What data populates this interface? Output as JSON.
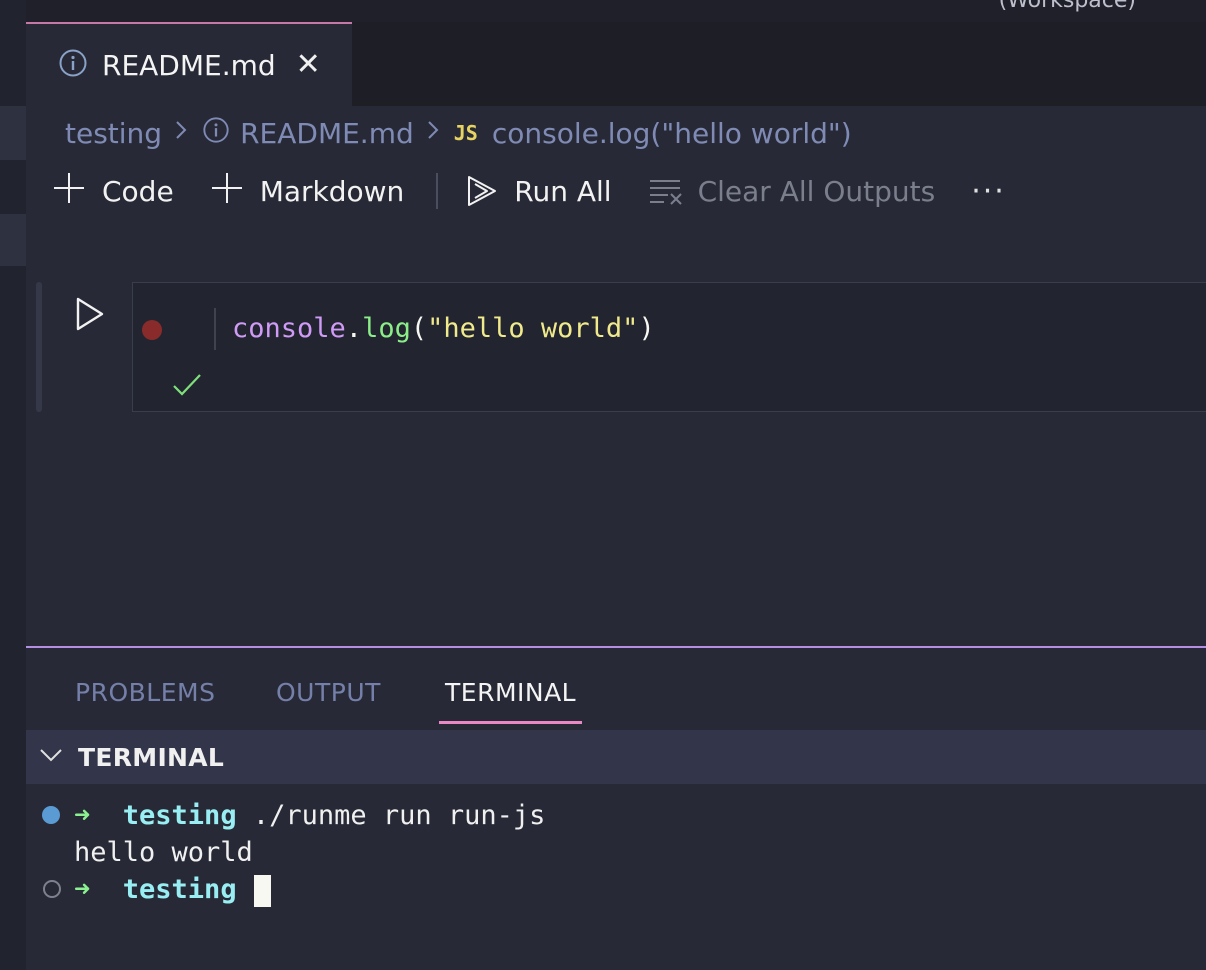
{
  "window": {
    "title_fragment": "(Workspace)"
  },
  "editor": {
    "tab": {
      "label": "README.md",
      "close": "✕"
    },
    "breadcrumb": {
      "folder": "testing",
      "file": "README.md",
      "lang": "JS",
      "symbol": "console.log(\"hello world\")"
    }
  },
  "toolbar": {
    "code": "Code",
    "markdown": "Markdown",
    "run_all": "Run All",
    "clear_outputs": "Clear All Outputs",
    "more": "···"
  },
  "cell": {
    "code": {
      "object": "console",
      "dot": ".",
      "method": "log",
      "open": "(",
      "string": "\"hello world\"",
      "close": ")"
    },
    "status": "success"
  },
  "panel": {
    "tabs": [
      "PROBLEMS",
      "OUTPUT",
      "TERMINAL"
    ],
    "active_tab": "TERMINAL",
    "section_title": "TERMINAL"
  },
  "terminal": {
    "line1": {
      "arrow": "➜",
      "cwd": "testing",
      "command": "./runme run run-js"
    },
    "output": "hello world",
    "line3": {
      "arrow": "➜",
      "cwd": "testing"
    }
  },
  "colors": {
    "accent_tab": "#c678a8",
    "panel_active": "#e988c4",
    "panel_divider": "#b48ee0",
    "js_badge": "#e7d362",
    "success": "#7ee07a",
    "breakpoint": "#8a2b2b"
  },
  "icons": [
    "info-icon",
    "chevron-right-icon",
    "plus-icon",
    "run-all-icon",
    "clear-outputs-icon",
    "more-icon",
    "play-icon",
    "checkmark-icon",
    "chevron-down-icon",
    "close-icon"
  ]
}
